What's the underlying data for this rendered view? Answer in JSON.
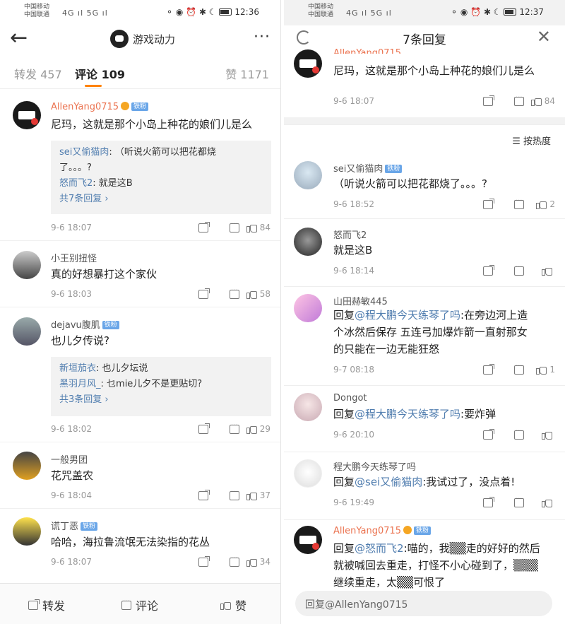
{
  "status_left": {
    "carrier1": "中国移动",
    "carrier2": "中国联通",
    "signal": "4G ıl 5G ıl",
    "time": "12:36",
    "icons": "⚬ ◉ ⏰ ✱ ☾"
  },
  "status_right": {
    "time": "12:37",
    "icons": "⚬ ◉ ⏰ ✱ ☾"
  },
  "left": {
    "account_name": "游戏动力",
    "tabs": [
      {
        "label": "转发 457"
      },
      {
        "label": "评论 109"
      },
      {
        "label": "赞 1171"
      }
    ],
    "comments": [
      {
        "name": "AllenYang0715",
        "badge": "铁粉",
        "text": "尼玛，这就是那个小岛上种花的娘们儿是么",
        "replies": [
          {
            "name": "sei又偷猫肉",
            "text": ": （听说火箭可以把花都烧"
          },
          {
            "name": "",
            "text": "了。。。?"
          },
          {
            "name": "怒而飞2",
            "text": ": 就是这B"
          }
        ],
        "more": "共7条回复 ›",
        "time": "9-6 18:07",
        "likes": "84"
      },
      {
        "name": "小王别扭怪",
        "text": "真的好想暴打这个家伙",
        "time": "9-6 18:03",
        "likes": "58"
      },
      {
        "name": "dejavu腹肌",
        "badge": "铁粉",
        "text": "也儿夕传说?",
        "replies": [
          {
            "name": "新垣茄衣",
            "text": ": 也儿夕坛说"
          },
          {
            "name": "黑羽月风_",
            "text": ": 乜mie儿夕不是更贴切?"
          }
        ],
        "more": "共3条回复 ›",
        "time": "9-6 18:02",
        "likes": "29"
      },
      {
        "name": "一般男团",
        "text": "花咒盖农",
        "time": "9-6 18:04",
        "likes": "37"
      },
      {
        "name": "谎丁恶",
        "badge": "铁粉",
        "text": "哈哈，海拉鲁流氓无法染指的花丛",
        "time": "9-6 18:07",
        "likes": "34"
      }
    ],
    "bottom": {
      "forward": "转发",
      "comment": "评论",
      "like": "赞"
    }
  },
  "right": {
    "title": "7条回复",
    "top": {
      "name": "AllenYang0715",
      "text": "尼玛，这就是那个小岛上种花的娘们儿是么",
      "time": "9-6 18:07",
      "likes": "84"
    },
    "sort": "☰ 按热度",
    "replies": [
      {
        "name": "sei又偷猫肉",
        "badge": "铁粉",
        "lines": [
          "（听说火箭可以把花都烧了。。。?"
        ],
        "time": "9-6 18:52",
        "likes": "2"
      },
      {
        "name": "怒而飞2",
        "lines": [
          "就是这B"
        ],
        "time": "9-6 18:14",
        "likes": ""
      },
      {
        "name": "山田赫敏445",
        "at": "@程大鹏今天练琴了吗",
        "lines": [
          ":在旁边河上造",
          "个冰然后保存 五连弓加爆炸箭一直射那女",
          "的只能在一边无能狂怒"
        ],
        "time": "9-7 08:18",
        "likes": "1"
      },
      {
        "name": "Dongot",
        "at": "@程大鹏今天练琴了吗",
        "lines": [
          ":要炸弹"
        ],
        "time": "9-6 20:10",
        "likes": ""
      },
      {
        "name": "程大鹏今天练琴了吗",
        "at": "@sei又偷猫肉",
        "lines": [
          ":我试过了，没点着!"
        ],
        "time": "9-6 19:49",
        "likes": ""
      },
      {
        "name": "AllenYang0715",
        "badge": "铁粉",
        "at": "@怒而飞2",
        "lines": [
          ":喵的，我▒▒走的好好的然后",
          "就被喊回去重走，打怪不小心碰到了，▒▒▒",
          "继续重走，太▒▒可恨了"
        ],
        "time": "",
        "likes": ""
      }
    ],
    "reply_prefix": "回复",
    "input_placeholder": "回复@AllenYang0715"
  }
}
